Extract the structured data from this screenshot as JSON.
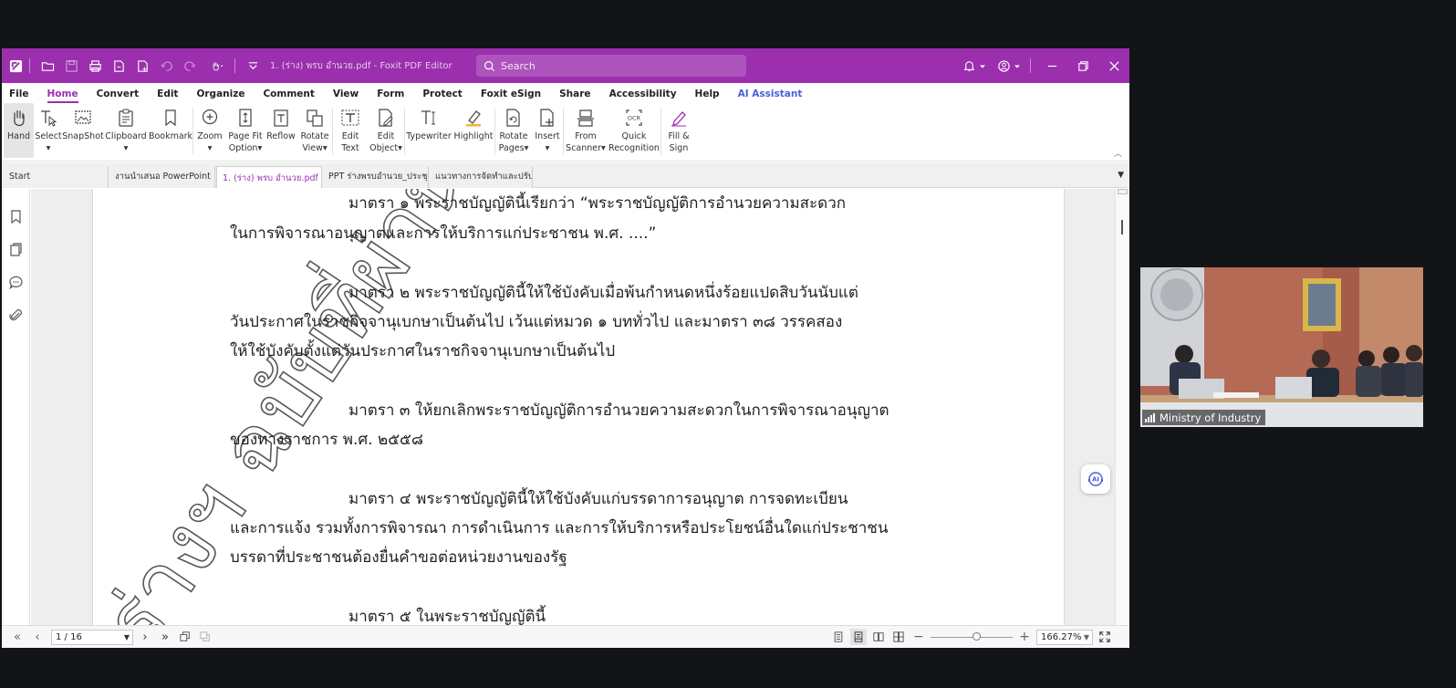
{
  "window": {
    "title": "1. (ร่าง) พรบ อำนวย.pdf - Foxit PDF Editor",
    "search_placeholder": "Search"
  },
  "menu": {
    "tabs": [
      "File",
      "Home",
      "Convert",
      "Edit",
      "Organize",
      "Comment",
      "View",
      "Form",
      "Protect",
      "Foxit eSign",
      "Share",
      "Accessibility",
      "Help",
      "AI Assistant"
    ],
    "active": "Home"
  },
  "ribbon": {
    "hand": "Hand",
    "select": "Select",
    "snapshot": "SnapShot",
    "clipboard": "Clipboard",
    "bookmark": "Bookmark",
    "zoom": "Zoom",
    "page_fit_1": "Page Fit",
    "page_fit_2": "Option",
    "reflow": "Reflow",
    "rotate_view_1": "Rotate",
    "rotate_view_2": "View",
    "edit_text_1": "Edit",
    "edit_text_2": "Text",
    "edit_object_1": "Edit",
    "edit_object_2": "Object",
    "typewriter": "Typewriter",
    "highlight": "Highlight",
    "rotate_pages_1": "Rotate",
    "rotate_pages_2": "Pages",
    "insert": "Insert",
    "from_scanner_1": "From",
    "from_scanner_2": "Scanner",
    "quick_recognition_1": "Quick",
    "quick_recognition_2": "Recognition",
    "fill_sign_1": "Fill &",
    "fill_sign_2": "Sign",
    "ocr_badge": "OCR"
  },
  "doc_tabs": [
    {
      "label": "Start"
    },
    {
      "label": "งานนำเสนอ PowerPoint"
    },
    {
      "label": "1. (ร่าง) พรบ อำนวย.pdf"
    },
    {
      "label": "PPT ร่างพรบอำนวย_ประชุม..."
    },
    {
      "label": "แนวทางการจัดทำและปรับป..."
    }
  ],
  "document": {
    "lines": [
      "มาตรา ๑  พระราชบัญญัตินี้เรียกว่า “พระราชบัญญัติการอำนวยความสะดวก",
      "ในการพิจารณาอนุญาตและการให้บริการแก่ประชาชน พ.ศ. ....”",
      "มาตรา ๒  พระราชบัญญัตินี้ให้ใช้บังคับเมื่อพ้นกำหนดหนึ่งร้อยแปดสิบวันนับแต่",
      "วันประกาศในราชกิจจานุเบกษาเป็นต้นไป เว้นแต่หมวด ๑ บททั่วไป และมาตรา ๓๘ วรรคสอง",
      "ให้ใช้บังคับตั้งแต่วันประกาศในราชกิจจานุเบกษาเป็นต้นไป",
      "มาตรา ๓  ให้ยกเลิกพระราชบัญญัติการอำนวยความสะดวกในการพิจารณาอนุญาต",
      "ของทางราชการ พ.ศ. ๒๕๕๘",
      "มาตรา ๔  พระราชบัญญัตินี้ให้ใช้บังคับแก่บรรดาการอนุญาต การจดทะเบียน",
      "และการแจ้ง รวมทั้งการพิจารณา การดำเนินการ และการให้บริการหรือประโยชน์อื่นใดแก่ประชาชน",
      "บรรดาที่ประชาชนต้องยื่นคำขอต่อหน่วยงานของรัฐ",
      "มาตรา ๕  ในพระราชบัญญัตินี้"
    ],
    "watermark": "ร่างฯ ฉบับที่ผ่านคณะ"
  },
  "ai_float_label": "AI",
  "status": {
    "page": "1 / 16",
    "zoom": "166.27%",
    "zoom_level_fraction": 0.55
  },
  "video": {
    "participant": "Ministry of Industry"
  }
}
